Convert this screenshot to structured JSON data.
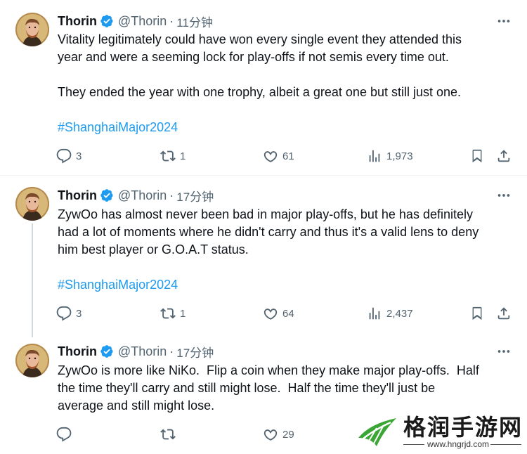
{
  "tweets": [
    {
      "name": "Thorin",
      "handle": "@Thorin",
      "separator": "·",
      "time": "11分钟",
      "text": "Vitality legitimately could have won every single event they attended this\nyear and were a seeming lock for play-offs if not semis every time out.\n\nThey ended the year with one trophy, albeit a great one but still just one.",
      "hashtag": "#ShanghaiMajor2024",
      "replies": "3",
      "reposts": "1",
      "likes": "61",
      "views": "1,973"
    },
    {
      "name": "Thorin",
      "handle": "@Thorin",
      "separator": "·",
      "time": "17分钟",
      "text": "ZywOo has almost never been bad in major play-offs, but he has definitely\nhad a lot of moments where he didn't carry and thus it's a valid lens to deny\nhim best player or G.O.A.T status.",
      "hashtag": "#ShanghaiMajor2024",
      "replies": "3",
      "reposts": "1",
      "likes": "64",
      "views": "2,437"
    },
    {
      "name": "Thorin",
      "handle": "@Thorin",
      "separator": "·",
      "time": "17分钟",
      "text": "ZywOo is more like NiKo.  Flip a coin when they make major play-offs.  Half\nthe time they'll carry and still might lose.  Half the time they'll just be\naverage and still might lose.",
      "likes": "29"
    }
  ],
  "watermark": {
    "title": "格润手游网",
    "url": "www.hngrjd.com"
  },
  "colors": {
    "accent": "#1d9bf0",
    "muted": "#536471",
    "text": "#0f1419",
    "divider": "#eff3f4",
    "watermark_green": "#3aa635"
  },
  "icons": [
    "reply-icon",
    "repost-icon",
    "like-icon",
    "views-icon",
    "bookmark-icon",
    "share-icon",
    "more-icon",
    "verified-badge-icon"
  ]
}
